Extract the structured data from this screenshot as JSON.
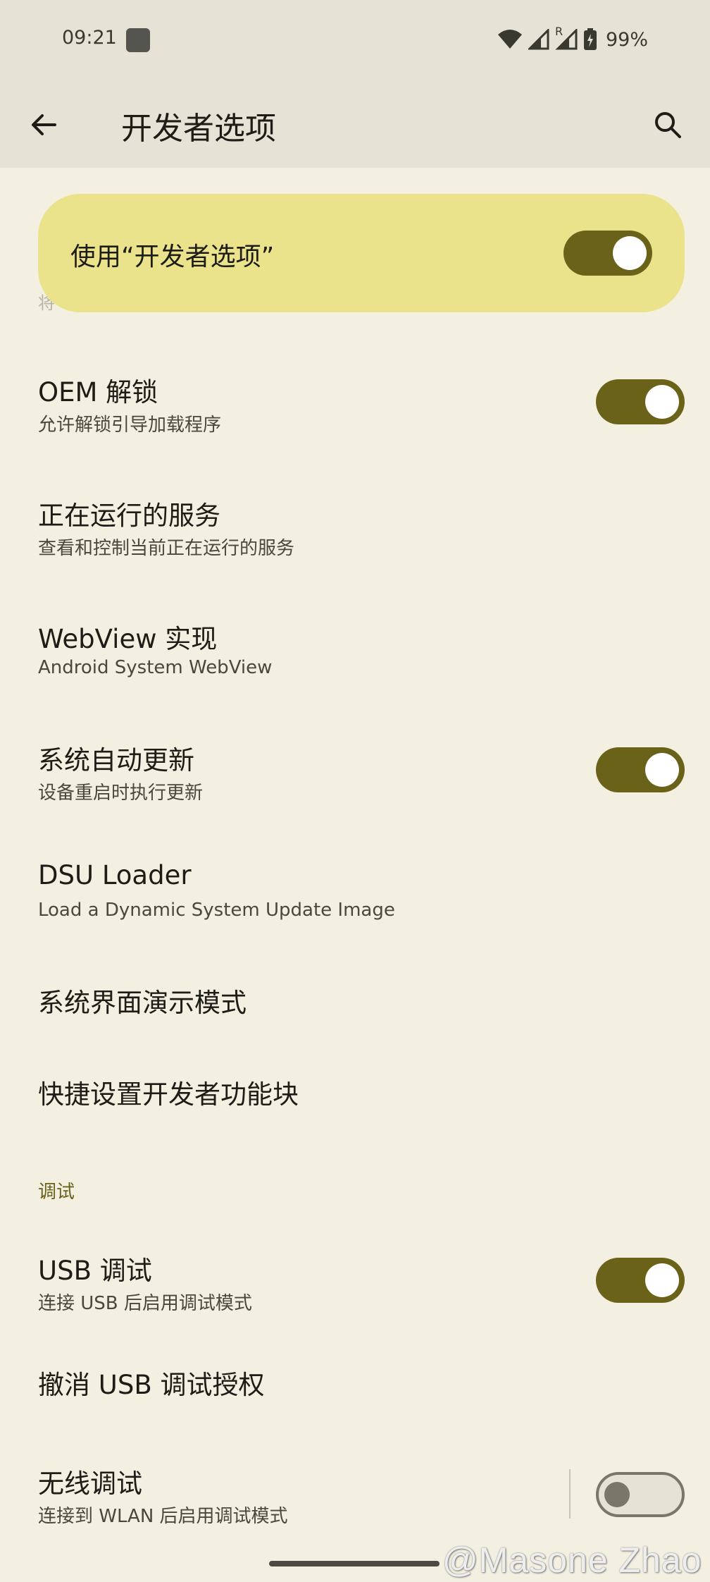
{
  "status_bar": {
    "time": "09:21",
    "battery_percent": "99%",
    "roaming_label": "R"
  },
  "app_bar": {
    "title": "开发者选项"
  },
  "master_switch": {
    "label": "使用“开发者选项”",
    "hint": "将",
    "enabled": true
  },
  "settings": [
    {
      "title": "OEM 解锁",
      "subtitle": "允许解锁引导加载程序",
      "toggle": "on"
    },
    {
      "title": "正在运行的服务",
      "subtitle": "查看和控制当前正在运行的服务"
    },
    {
      "title": "WebView 实现",
      "subtitle": "Android System WebView"
    },
    {
      "title": "系统自动更新",
      "subtitle": "设备重启时执行更新",
      "toggle": "on"
    },
    {
      "title": "DSU Loader",
      "subtitle": "Load a Dynamic System Update Image"
    },
    {
      "title": "系统界面演示模式"
    },
    {
      "title": "快捷设置开发者功能块"
    }
  ],
  "debug_section": {
    "header": "调试",
    "items": [
      {
        "title": "USB 调试",
        "subtitle": "连接 USB 后启用调试模式",
        "toggle": "on"
      },
      {
        "title": "撤消 USB 调试授权"
      },
      {
        "title": "无线调试",
        "subtitle": "连接到 WLAN 后启用调试模式",
        "toggle": "off"
      }
    ]
  },
  "watermark": "@Masone Zhao",
  "colors": {
    "accent": "#6a6218",
    "card": "#ebe38c",
    "background": "#f3f0e2",
    "app_bar": "#e6e2d6"
  }
}
